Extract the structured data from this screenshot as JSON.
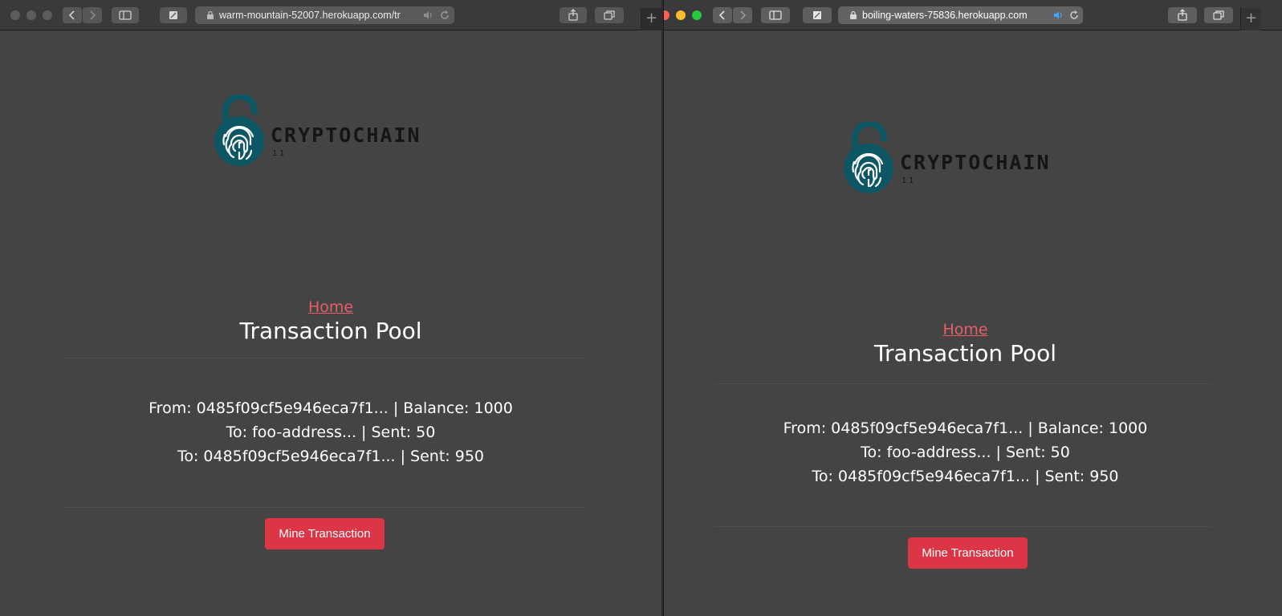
{
  "windows": [
    {
      "id": "left",
      "url": "warm-mountain-52007.herokuapp.com/tr",
      "logo": {
        "name": "CRYPTOCHAIN",
        "sub": "11"
      },
      "nav": {
        "home_label": "Home"
      },
      "page_title": "Transaction Pool",
      "transaction": {
        "from_line": "From: 0485f09cf5e946eca7f1... | Balance: 1000",
        "outputs": [
          "To: foo-address... | Sent: 50",
          "To: 0485f09cf5e946eca7f1... | Sent: 950"
        ]
      },
      "mine_button_label": "Mine Transaction"
    },
    {
      "id": "right",
      "url": "boiling-waters-75836.herokuapp.com",
      "logo": {
        "name": "CRYPTOCHAIN",
        "sub": "11"
      },
      "nav": {
        "home_label": "Home"
      },
      "page_title": "Transaction Pool",
      "transaction": {
        "from_line": "From: 0485f09cf5e946eca7f1... | Balance: 1000",
        "outputs": [
          "To: foo-address... | Sent: 50",
          "To: 0485f09cf5e946eca7f1... | Sent: 950"
        ]
      },
      "mine_button_label": "Mine Transaction"
    }
  ],
  "colors": {
    "page_bg": "#444444",
    "link": "#e85d66",
    "button": "#dc3545",
    "logo_teal": "#0d5664",
    "traffic_red": "#fe5f57",
    "traffic_yellow": "#febc2e",
    "traffic_green": "#28c840"
  },
  "icons": [
    "back-icon",
    "forward-icon",
    "sidebar-icon",
    "tab-icon",
    "lock-icon",
    "speaker-icon",
    "reload-icon",
    "share-icon",
    "tabs-overview-icon",
    "new-tab-icon",
    "fingerprint-lock-icon"
  ]
}
